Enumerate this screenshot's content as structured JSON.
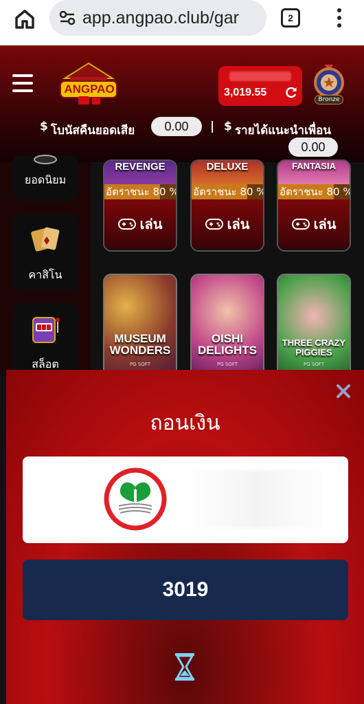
{
  "browser": {
    "url": "app.angpao.club/gar",
    "tab_count": "2"
  },
  "header": {
    "logo_text": "ANGPAO",
    "balance": "3,019.55",
    "rank": "Bronze",
    "cashback_label": "โบนัสคืนยอดเสีย",
    "cashback_value": "0.00",
    "referral_label": "รายได้แนะนำเพื่อน",
    "referral_value": "0.00",
    "separator": "|",
    "currency_symbol": "$"
  },
  "sidebar": {
    "items": [
      {
        "label": "ยอดนิยม"
      },
      {
        "label": "คาสิโน"
      },
      {
        "label": "สล็อต"
      }
    ]
  },
  "games": {
    "row1": [
      {
        "title": "REVENGE",
        "rate": "อัตราชนะ 80 %",
        "play": "เล่น"
      },
      {
        "title": "DELUXE",
        "rate": "อัตราชนะ 80 %",
        "play": "เล่น"
      },
      {
        "title": "FANTASIA",
        "rate": "อัตราชนะ 80 %",
        "play": "เล่น"
      }
    ],
    "row2": [
      {
        "title": "MUSEUM WONDERS",
        "maker": "PG SOFT"
      },
      {
        "title": "OISHI DELIGHTS",
        "maker": "PG SOFT"
      },
      {
        "title": "THREE CRAZY PIGGIES",
        "maker": "PG SOFT"
      }
    ]
  },
  "modal": {
    "title": "ถอนเงิน",
    "amount": "3019"
  },
  "colors": {
    "header_red": "#7a0709",
    "balance_red": "#d10c12",
    "amount_bg": "#18294e",
    "bank_green": "#1a9e3c"
  }
}
